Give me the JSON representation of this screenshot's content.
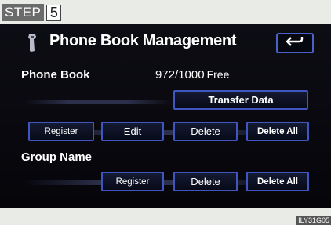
{
  "step": {
    "label": "STEP",
    "number": "5"
  },
  "header": {
    "title": "Phone Book Management"
  },
  "phone_book": {
    "label": "Phone Book",
    "count": "972/1000",
    "free": "Free",
    "transfer_label": "Transfer Data",
    "register_label": "Register",
    "edit_label": "Edit",
    "delete_label": "Delete",
    "delete_all_label": "Delete All"
  },
  "group_name": {
    "label": "Group Name",
    "register_label": "Register",
    "delete_label": "Delete",
    "delete_all_label": "Delete All"
  },
  "footer": {
    "code": "ILY31G05"
  },
  "colors": {
    "accent": "#3f55bf",
    "screen_bg": "#07070d",
    "page_bg": "#e9ebe6"
  },
  "icons": {
    "phone": "phone-icon",
    "back": "return-arrow-icon"
  }
}
